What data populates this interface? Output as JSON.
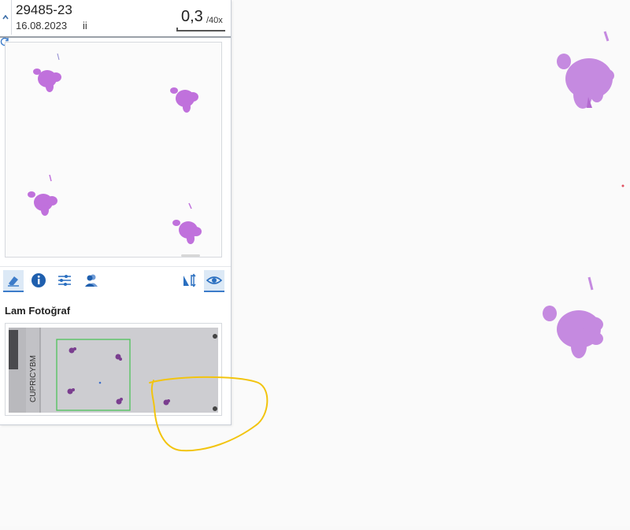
{
  "case": {
    "id": "29485-23",
    "date": "16.08.2023",
    "flag": "ii"
  },
  "scale": {
    "value": "0,3",
    "unit": "/40x"
  },
  "toolbar": {
    "items": [
      {
        "icon": "eraser-icon",
        "active": true
      },
      {
        "icon": "info-icon",
        "active": false
      },
      {
        "icon": "sliders-icon",
        "active": false
      },
      {
        "icon": "users-icon",
        "active": false
      },
      {
        "icon": "flip-icon",
        "active": false
      },
      {
        "icon": "eye-icon",
        "active": true
      }
    ]
  },
  "photo": {
    "label": "Lam Fotoğraf",
    "slide_label_text": "CUPRICYBM"
  },
  "colors": {
    "tissue": "#b36acf",
    "tissue_dark": "#8e3fb0",
    "accent": "#3d7cc9",
    "annotation": "#f2c40f",
    "roi": "#4fc35a"
  }
}
